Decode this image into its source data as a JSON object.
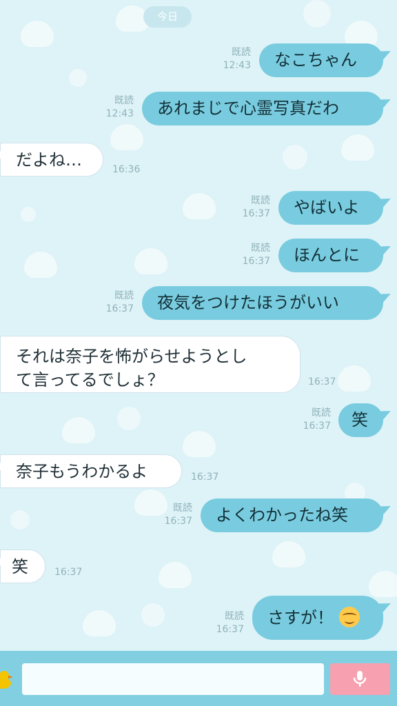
{
  "date_divider": "今日",
  "messages": [
    {
      "dir": "out",
      "text": "なこちゃん",
      "read": "既読",
      "time": "12:43"
    },
    {
      "dir": "out",
      "text": "あれまじで心霊写真だわ",
      "read": "既読",
      "time": "12:43"
    },
    {
      "dir": "in",
      "text": "だよね…",
      "time": "16:36"
    },
    {
      "dir": "out",
      "text": "やばいよ",
      "read": "既読",
      "time": "16:37"
    },
    {
      "dir": "out",
      "text": "ほんとに",
      "read": "既読",
      "time": "16:37"
    },
    {
      "dir": "out",
      "text": "夜気をつけたほうがいい",
      "read": "既読",
      "time": "16:37"
    },
    {
      "dir": "in",
      "lines": [
        "それは奈子を怖がらせようとし",
        "て言ってるでしょ？"
      ],
      "time": "16:37"
    },
    {
      "dir": "out",
      "text": "笑",
      "read": "既読",
      "time": "16:37"
    },
    {
      "dir": "in",
      "text": "奈子もうわかるよ",
      "time": "16:37"
    },
    {
      "dir": "out",
      "text": "よくわかったね笑",
      "read": "既読",
      "time": "16:37"
    },
    {
      "dir": "in",
      "text": "笑",
      "time": "16:37"
    },
    {
      "dir": "out",
      "text": "さすが！",
      "emoji": "smiling-face-emoji",
      "read": "既読",
      "time": "16:37"
    }
  ],
  "input": {
    "placeholder": "",
    "mic_icon": "microphone-icon",
    "sticker_icon": "duck-sticker-icon"
  },
  "colors": {
    "outgoing": "#79ccdf",
    "incoming": "#ffffff",
    "background": "#def3f7",
    "send_button": "#f7a0b0",
    "input_bar": "#82cfe2"
  }
}
